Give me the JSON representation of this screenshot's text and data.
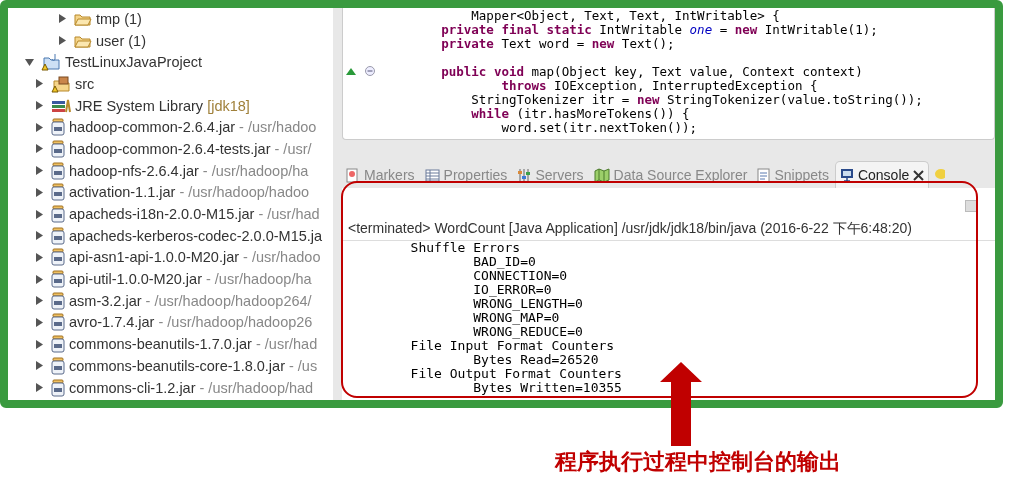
{
  "tree": {
    "upper_items": [
      {
        "label": "tmp (1)",
        "kind": "folder",
        "expanded": false
      },
      {
        "label": "user (1)",
        "kind": "folder",
        "expanded": false
      }
    ],
    "items": [
      {
        "label": "TestLinuxJavaProject",
        "kind": "project",
        "expanded": true,
        "children": [
          {
            "label": "src",
            "kind": "source-folder",
            "expanded": false
          },
          {
            "label": "JRE System Library",
            "decoration": "[jdk18]",
            "kind": "library",
            "expanded": false
          },
          {
            "label": "hadoop-common-2.6.4.jar",
            "decoration": "- /usr/hadoo",
            "kind": "jar",
            "expanded": false
          },
          {
            "label": "hadoop-common-2.6.4-tests.jar",
            "decoration": "- /usr/",
            "kind": "jar",
            "expanded": false
          },
          {
            "label": "hadoop-nfs-2.6.4.jar",
            "decoration": "- /usr/hadoop/ha",
            "kind": "jar",
            "expanded": false
          },
          {
            "label": "activation-1.1.jar",
            "decoration": "- /usr/hadoop/hadoo",
            "kind": "jar",
            "expanded": false
          },
          {
            "label": "apacheds-i18n-2.0.0-M15.jar",
            "decoration": "- /usr/had",
            "kind": "jar",
            "expanded": false
          },
          {
            "label": "apacheds-kerberos-codec-2.0.0-M15.ja",
            "kind": "jar",
            "expanded": false
          },
          {
            "label": "api-asn1-api-1.0.0-M20.jar",
            "decoration": "- /usr/hadoo",
            "kind": "jar",
            "expanded": false
          },
          {
            "label": "api-util-1.0.0-M20.jar",
            "decoration": "- /usr/hadoop/ha",
            "kind": "jar",
            "expanded": false
          },
          {
            "label": "asm-3.2.jar",
            "decoration": "- /usr/hadoop/hadoop264/",
            "kind": "jar",
            "expanded": false
          },
          {
            "label": "avro-1.7.4.jar",
            "decoration": "- /usr/hadoop/hadoop26",
            "kind": "jar",
            "expanded": false
          },
          {
            "label": "commons-beanutils-1.7.0.jar",
            "decoration": "- /usr/had",
            "kind": "jar",
            "expanded": false
          },
          {
            "label": "commons-beanutils-core-1.8.0.jar",
            "decoration": "- /us",
            "kind": "jar",
            "expanded": false
          },
          {
            "label": "commons-cli-1.2.jar",
            "decoration": "- /usr/hadoop/had",
            "kind": "jar",
            "expanded": false
          }
        ]
      }
    ]
  },
  "editor": {
    "lines": [
      {
        "kind": "code",
        "override": false,
        "foldable": false,
        "text": "            Mapper<Object, Text, Text, IntWritable> {"
      },
      {
        "kind": "code",
        "override": false,
        "foldable": false,
        "text": "        **private final static** IntWritable *one* = **new** IntWritable(1);"
      },
      {
        "kind": "code",
        "override": false,
        "foldable": false,
        "text": "        **private** Text word = **new** Text();"
      },
      {
        "kind": "blank",
        "override": false,
        "foldable": false
      },
      {
        "kind": "code",
        "override": true,
        "foldable": true,
        "text": "        **public void** map(Object key, Text value, Context context)"
      },
      {
        "kind": "code",
        "override": false,
        "foldable": false,
        "text": "                **throws** IOException, InterruptedException {"
      },
      {
        "kind": "code",
        "override": false,
        "foldable": false,
        "text": "            StringTokenizer itr = **new** StringTokenizer(value.toString());"
      },
      {
        "kind": "code",
        "override": false,
        "foldable": false,
        "text": "            **while** (itr.hasMoreTokens()) {"
      },
      {
        "kind": "code",
        "override": false,
        "foldable": false,
        "text": "                word.set(itr.nextToken());"
      }
    ]
  },
  "tabs": [
    {
      "label": "Markers",
      "kind": "markers",
      "selected": false
    },
    {
      "label": "Properties",
      "kind": "properties",
      "selected": false
    },
    {
      "label": "Servers",
      "kind": "servers",
      "selected": false
    },
    {
      "label": "Data Source Explorer",
      "kind": "datasource",
      "selected": false
    },
    {
      "label": "Snippets",
      "kind": "snippets",
      "selected": false
    },
    {
      "label": "Console",
      "kind": "console",
      "selected": true
    }
  ],
  "console": {
    "header": "<terminated> WordCount [Java Application] /usr/jdk/jdk18/bin/java (2016-6-22 下午6:48:20)",
    "lines": [
      "        Shuffle Errors",
      "                BAD_ID=0",
      "                CONNECTION=0",
      "                IO_ERROR=0",
      "                WRONG_LENGTH=0",
      "                WRONG_MAP=0",
      "                WRONG_REDUCE=0",
      "        File Input Format Counters",
      "                Bytes Read=26520",
      "        File Output Format Counters",
      "                Bytes Written=10355"
    ]
  },
  "annotation": {
    "caption": "程序执行过程中控制台的输出"
  }
}
